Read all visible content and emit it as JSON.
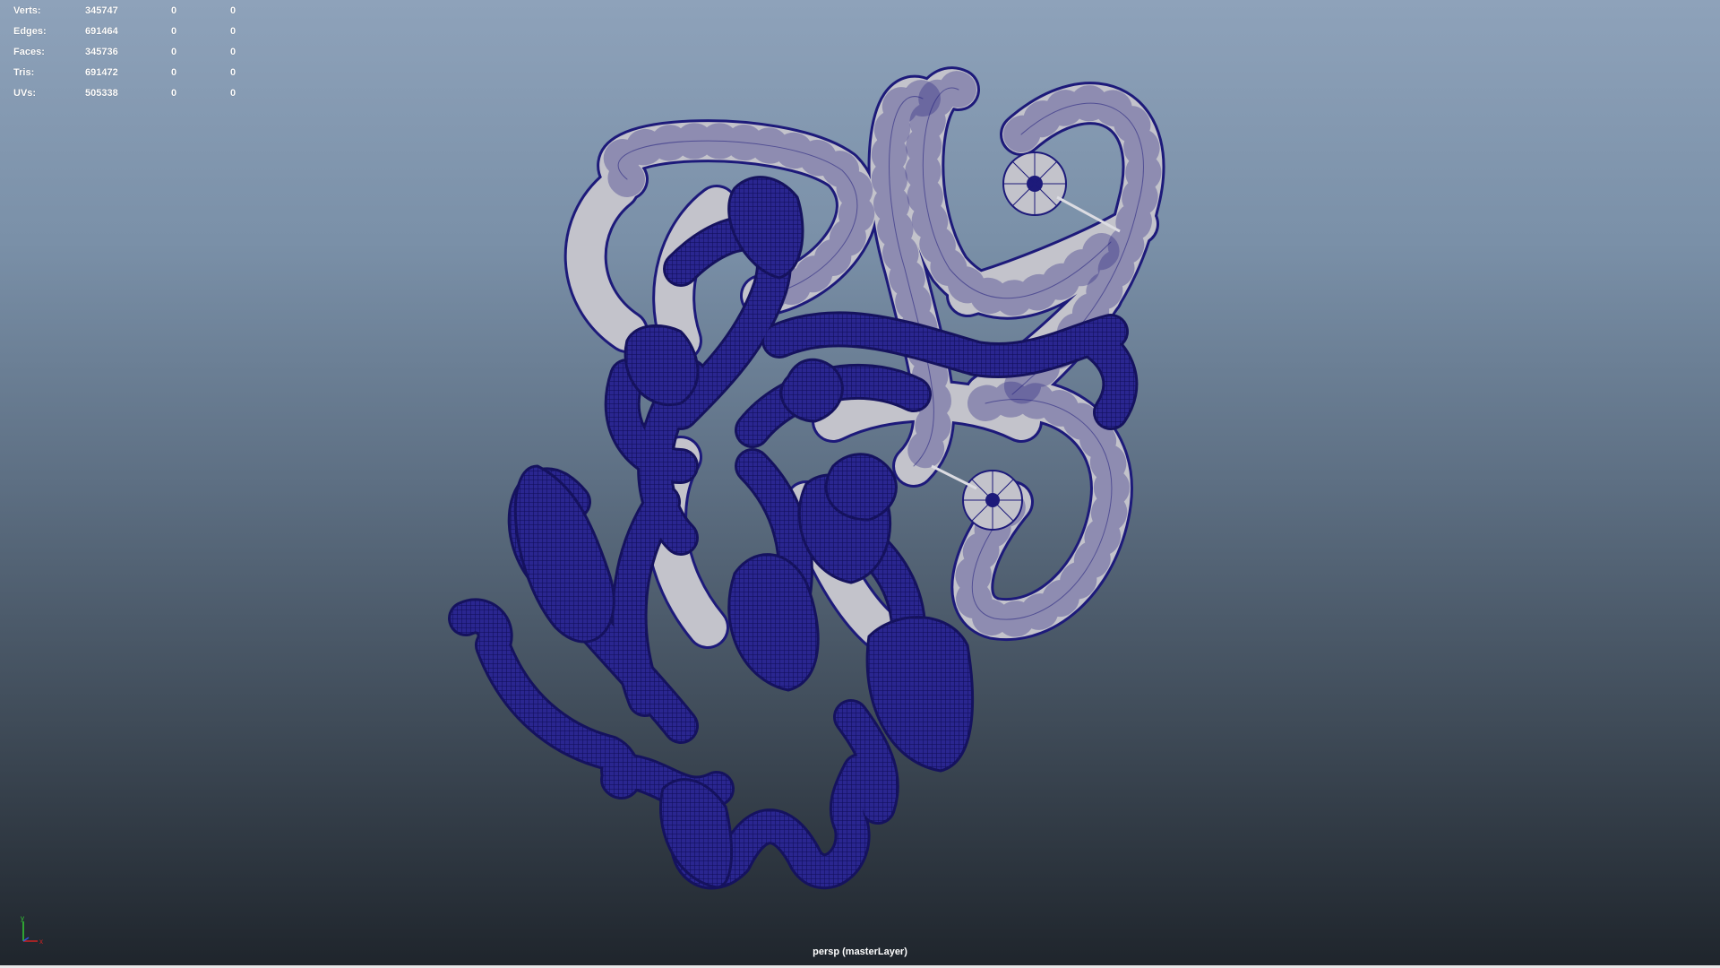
{
  "viewport": {
    "camera_label": "persp (masterLayer)",
    "background_top": "#8ea2ba",
    "background_bottom": "#1f252c"
  },
  "hud_stats": [
    {
      "label": "Verts:",
      "value": "345747",
      "selected": "0",
      "components": "0"
    },
    {
      "label": "Edges:",
      "value": "691464",
      "selected": "0",
      "components": "0"
    },
    {
      "label": "Faces:",
      "value": "345736",
      "selected": "0",
      "components": "0"
    },
    {
      "label": "Tris:",
      "value": "691472",
      "selected": "0",
      "components": "0"
    },
    {
      "label": "UVs:",
      "value": "505338",
      "selected": "0",
      "components": "0"
    }
  ],
  "axis_gizmo": {
    "y_label": "y",
    "x_label": "x",
    "y_color": "#33cc33",
    "x_color": "#cc2222",
    "z_color": "#3355dd"
  },
  "model": {
    "name": "protein-ribbon-mesh",
    "tube_color": "#bdbdc5",
    "wire_color": "#1d1a7a",
    "ribbon_color": "#1a1670"
  }
}
